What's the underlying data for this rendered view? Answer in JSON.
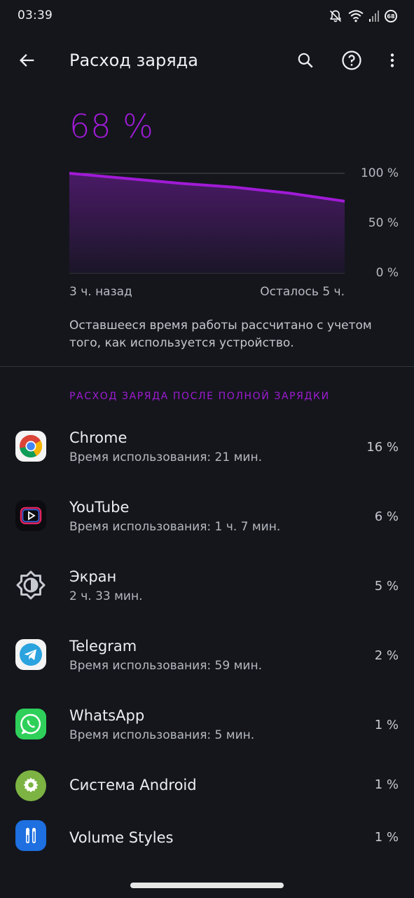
{
  "status_bar": {
    "time": "03:39",
    "battery_level": "68"
  },
  "toolbar": {
    "title": "Расход заряда",
    "back_icon": "arrow-back-icon",
    "search_icon": "search-icon",
    "help_icon": "help-icon",
    "more_icon": "more-vert-icon"
  },
  "battery": {
    "percent_label": "68 %",
    "chart": {
      "y_labels": [
        "100 %",
        "50 %",
        "0 %"
      ],
      "x_start_label": "3 ч. назад",
      "x_end_label": "Осталось 5 ч."
    },
    "note": "Оставшееся время работы рассчитано с учетом того, как используется устройство."
  },
  "chart_data": {
    "type": "area",
    "x": [
      0,
      0.2,
      0.4,
      0.6,
      0.8,
      1.0
    ],
    "values": [
      100,
      95,
      90,
      86,
      80,
      72
    ],
    "ylim": [
      0,
      100
    ],
    "line_color": "#a01bd6"
  },
  "usage_section": {
    "title": "РАСХОД ЗАРЯДА ПОСЛЕ ПОЛНОЙ ЗАРЯДКИ",
    "apps": [
      {
        "name": "Chrome",
        "sub": "Время использования: 21 мин.",
        "percent": "16 %",
        "icon": "chrome-icon"
      },
      {
        "name": "YouTube",
        "sub": "Время использования: 1 ч. 7 мин.",
        "percent": "6 %",
        "icon": "youtube-icon"
      },
      {
        "name": "Экран",
        "sub": "2 ч. 33 мин.",
        "percent": "5 %",
        "icon": "brightness-icon"
      },
      {
        "name": "Telegram",
        "sub": "Время использования: 59 мин.",
        "percent": "2 %",
        "icon": "telegram-icon"
      },
      {
        "name": "WhatsApp",
        "sub": "Время использования: 5 мин.",
        "percent": "1 %",
        "icon": "whatsapp-icon"
      },
      {
        "name": "Система Android",
        "sub": "",
        "percent": "1 %",
        "icon": "android-system-icon"
      },
      {
        "name": "Volume Styles",
        "sub": "",
        "percent": "1 %",
        "icon": "volume-styles-icon"
      }
    ]
  }
}
